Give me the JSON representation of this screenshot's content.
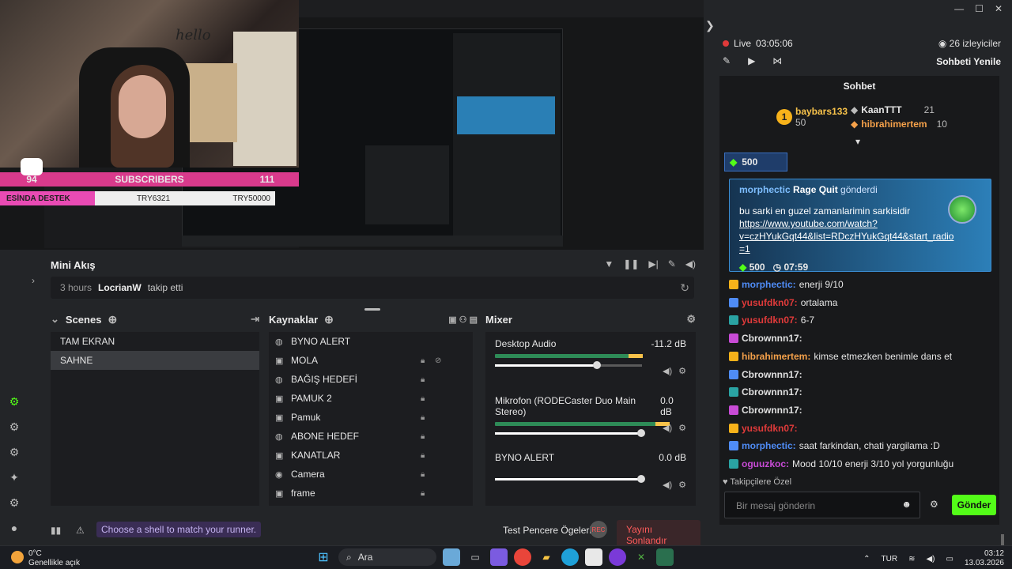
{
  "overlay": {
    "sub_count": "94",
    "sub_label": "SUBSCRIBERS",
    "sub_goal": "111",
    "destek_label": "ESİNDA DESTEK",
    "destek_code": "TRY6321",
    "destek_goal": "TRY50000",
    "hello_text": "hello"
  },
  "mini_akis": {
    "title": "Mini Akış",
    "event_time": "3 hours",
    "event_user": "LocrianW",
    "event_action": "takip etti"
  },
  "scenes": {
    "title": "Scenes",
    "items": [
      {
        "label": "TAM EKRAN"
      },
      {
        "label": "SAHNE"
      }
    ]
  },
  "sources": {
    "title": "Kaynaklar",
    "items": [
      {
        "label": "BYNO ALERT",
        "icon": "globe-icon"
      },
      {
        "label": "MOLA",
        "icon": "image-icon"
      },
      {
        "label": "BAĞIŞ HEDEFİ",
        "icon": "globe-icon"
      },
      {
        "label": "PAMUK 2",
        "icon": "image-icon"
      },
      {
        "label": "Pamuk",
        "icon": "image-icon"
      },
      {
        "label": "ABONE HEDEF",
        "icon": "globe-icon"
      },
      {
        "label": "KANATLAR",
        "icon": "image-icon"
      },
      {
        "label": "Camera",
        "icon": "camera-icon"
      },
      {
        "label": "frame",
        "icon": "image-icon"
      }
    ]
  },
  "mixer": {
    "title": "Mixer",
    "channels": [
      {
        "name": "Desktop Audio",
        "db": "-11.2 dB",
        "level": 0.78,
        "volume": 0.7
      },
      {
        "name": "Mikrofon (RODECaster Duo Main Stereo)",
        "db": "0.0 dB",
        "level": 0.92,
        "volume": 1.0
      },
      {
        "name": "BYNO ALERT",
        "db": "0.0 dB",
        "level": 0.0,
        "volume": 1.0
      }
    ]
  },
  "status": {
    "tip": "Choose a shell to match your runner.",
    "test_label": "Test Pencere Ögeleri",
    "rec_label": "REC",
    "end_label": "Yayını Sonlandır"
  },
  "chat": {
    "live_label": "Live",
    "live_time": "03:05:06",
    "viewers": "26 izleyiciler",
    "refresh_label": "Sohbeti Yenile",
    "title": "Sohbet",
    "leaders": [
      {
        "user": "baybars133",
        "count": "50"
      },
      {
        "user": "KaanTTT",
        "count": "21"
      },
      {
        "user": "hibrahimertem",
        "count": "10"
      }
    ],
    "pinned_amount": "500",
    "highlight": {
      "user": "morphectic",
      "action": "Rage Quit",
      "suffix": "gönderdi",
      "message": "bu sarki en guzel zamanlarimin sarkisidir",
      "link1": "https://www.youtube.com/watch?",
      "link2": "v=czHYukGqt44&list=RDczHYukGqt44&start_radio",
      "link3": "=1",
      "amount": "500",
      "timer": "07:59"
    },
    "messages": [
      {
        "user": "morphectic:",
        "text": "enerji 9/10",
        "color": "#4f8cf6"
      },
      {
        "user": "yusufdkn07:",
        "text": "ortalama",
        "color": "#e03a3a"
      },
      {
        "user": "yusufdkn07:",
        "text": "6-7",
        "color": "#e03a3a"
      },
      {
        "user": "Cbrownnn17:",
        "text": "",
        "color": "#e0e0e0"
      },
      {
        "user": "hibrahimertem:",
        "text": "kimse etmezken benimle dans et",
        "color": "#f5a14a"
      },
      {
        "user": "Cbrownnn17:",
        "text": "",
        "color": "#e0e0e0"
      },
      {
        "user": "Cbrownnn17:",
        "text": "",
        "color": "#e0e0e0"
      },
      {
        "user": "Cbrownnn17:",
        "text": "",
        "color": "#e0e0e0"
      },
      {
        "user": "yusufdkn07:",
        "text": "",
        "color": "#e03a3a"
      },
      {
        "user": "morphectic:",
        "text": "saat farkindan, chati yargilama :D",
        "color": "#4f8cf6"
      },
      {
        "user": "oguuzkoc:",
        "text": "Mood 10/10 enerji 3/10 yol yorgunluğu",
        "color": "#c84bd6"
      }
    ],
    "followers_label": "Takipçilere Özel",
    "input_placeholder": "Bir mesaj gönderin",
    "send_label": "Gönder"
  },
  "taskbar": {
    "temp": "0°C",
    "weather": "Genellikle açık",
    "search": "Ara",
    "lang": "TUR",
    "time": "03:12",
    "date": "13.03.2026"
  },
  "colors": {
    "accent_green": "#53fc18",
    "sub_pink": "#d93a8c",
    "live_red": "#e03a3a"
  }
}
